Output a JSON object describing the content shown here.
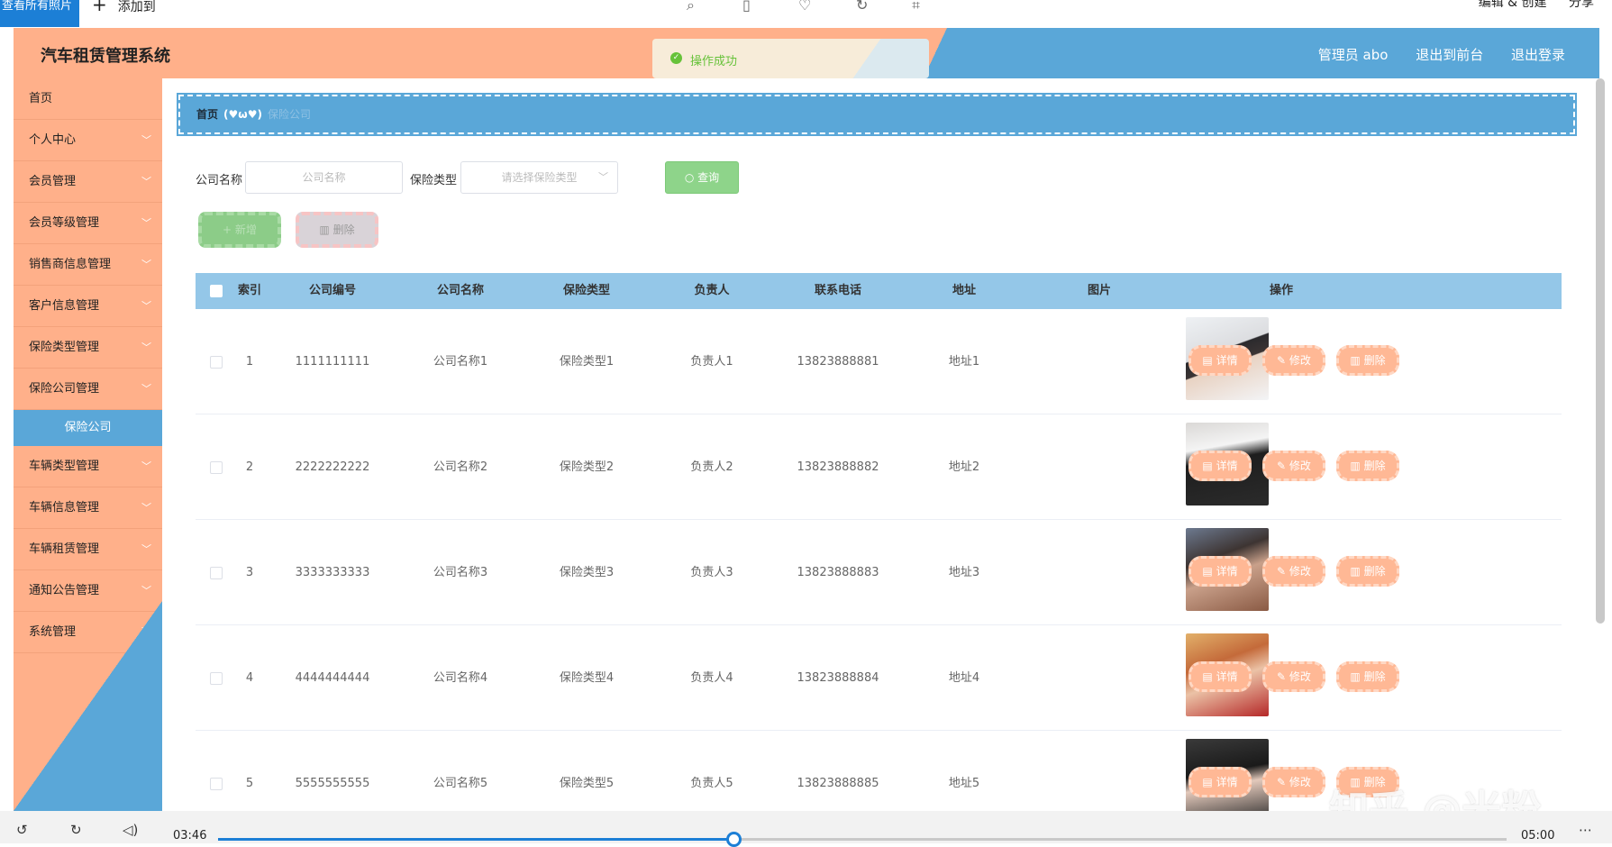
{
  "viewer": {
    "left_button": "查看所有照片",
    "add_label": "添加到",
    "edit_create": "编辑 & 创建",
    "share": "分享"
  },
  "header": {
    "title": "汽车租赁管理系统",
    "user": "管理员 abo",
    "to_front": "退出到前台",
    "logout": "退出登录"
  },
  "toast": {
    "message": "操作成功"
  },
  "sidebar": {
    "items": [
      {
        "label": "首页",
        "chevron": false
      },
      {
        "label": "个人中心",
        "chevron": true
      },
      {
        "label": "会员管理",
        "chevron": true
      },
      {
        "label": "会员等级管理",
        "chevron": true
      },
      {
        "label": "销售商信息管理",
        "chevron": true
      },
      {
        "label": "客户信息管理",
        "chevron": true
      },
      {
        "label": "保险类型管理",
        "chevron": true
      },
      {
        "label": "保险公司管理",
        "chevron": true
      }
    ],
    "active_sub": "保险公司",
    "items_after": [
      {
        "label": "车辆类型管理",
        "chevron": true
      },
      {
        "label": "车辆信息管理",
        "chevron": true
      },
      {
        "label": "车辆租赁管理",
        "chevron": true
      },
      {
        "label": "通知公告管理",
        "chevron": true
      },
      {
        "label": "系统管理",
        "chevron": true
      }
    ]
  },
  "breadcrumb": {
    "home": "首页",
    "separator": "(♥ω♥)",
    "current": "保险公司"
  },
  "search": {
    "company_label": "公司名称",
    "company_placeholder": "公司名称",
    "type_label": "保险类型",
    "type_placeholder": "请选择保险类型",
    "query_button": "查询"
  },
  "actions": {
    "add": "新增",
    "delete": "删除"
  },
  "table": {
    "headers": [
      "索引",
      "公司编号",
      "公司名称",
      "保险类型",
      "负责人",
      "联系电话",
      "地址",
      "图片",
      "操作"
    ],
    "op_labels": {
      "detail": "详情",
      "edit": "修改",
      "delete": "删除"
    },
    "rows": [
      {
        "index": "1",
        "code": "1111111111",
        "name": "公司名称1",
        "type": "保险类型1",
        "person": "负责人1",
        "phone": "13823888881",
        "address": "地址1"
      },
      {
        "index": "2",
        "code": "2222222222",
        "name": "公司名称2",
        "type": "保险类型2",
        "person": "负责人2",
        "phone": "13823888882",
        "address": "地址2"
      },
      {
        "index": "3",
        "code": "3333333333",
        "name": "公司名称3",
        "type": "保险类型3",
        "person": "负责人3",
        "phone": "13823888883",
        "address": "地址3"
      },
      {
        "index": "4",
        "code": "4444444444",
        "name": "公司名称4",
        "type": "保险类型4",
        "person": "负责人4",
        "phone": "13823888884",
        "address": "地址4"
      },
      {
        "index": "5",
        "code": "5555555555",
        "name": "公司名称5",
        "type": "保险类型5",
        "person": "负责人5",
        "phone": "13823888885",
        "address": "地址5"
      }
    ]
  },
  "watermark": "知乎 @米粉",
  "player": {
    "current_time": "03:46",
    "end_time": "05:00",
    "progress": 0.4
  },
  "colors": {
    "orange": "#ffb08a",
    "blue": "#5aa7d8",
    "accent": "#1c7fd6"
  }
}
